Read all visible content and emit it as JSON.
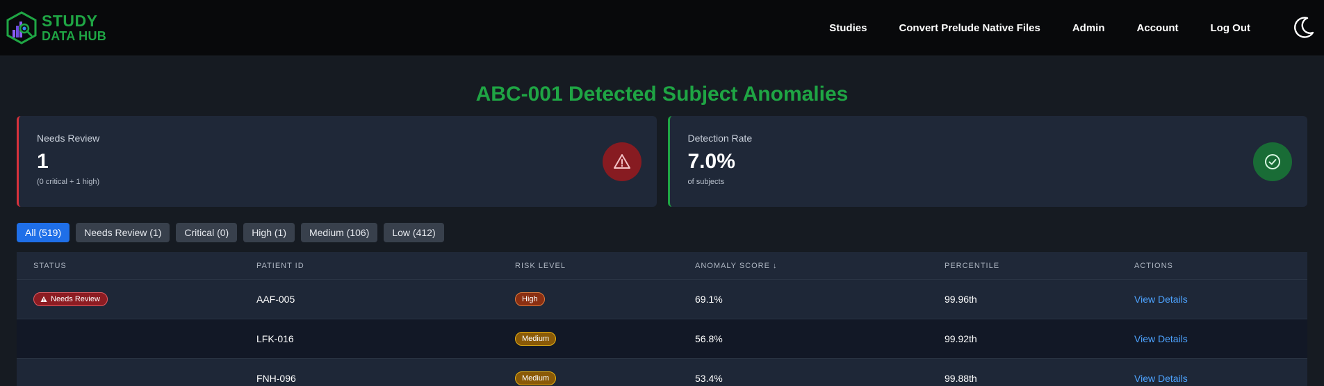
{
  "brand": {
    "line1": "STUDY",
    "line2": "DATA HUB",
    "accent": "#1fa544"
  },
  "nav": {
    "links": [
      "Studies",
      "Convert Prelude Native Files",
      "Admin",
      "Account",
      "Log Out"
    ],
    "theme_icon": "moon-icon"
  },
  "page": {
    "title": "ABC-001 Detected Subject Anomalies"
  },
  "cards": [
    {
      "label": "Needs Review",
      "value": "1",
      "sub": "(0 critical + 1 high)",
      "icon": "warning-icon",
      "color": "#d8323c"
    },
    {
      "label": "Detection Rate",
      "value": "7.0%",
      "sub": "of subjects",
      "icon": "check-circle-icon",
      "color": "#1fa544"
    }
  ],
  "filters": [
    {
      "label": "All (519)",
      "active": true
    },
    {
      "label": "Needs Review (1)",
      "active": false
    },
    {
      "label": "Critical (0)",
      "active": false
    },
    {
      "label": "High (1)",
      "active": false
    },
    {
      "label": "Medium (106)",
      "active": false
    },
    {
      "label": "Low (412)",
      "active": false
    }
  ],
  "table": {
    "headers": [
      "Status",
      "Patient ID",
      "Risk Level",
      "Anomaly Score ↓",
      "Percentile",
      "Actions"
    ],
    "rows": [
      {
        "status": "Needs Review",
        "patient_id": "AAF-005",
        "risk": "High",
        "score": "69.1%",
        "percentile": "99.96th",
        "action": "View Details"
      },
      {
        "status": "",
        "patient_id": "LFK-016",
        "risk": "Medium",
        "score": "56.8%",
        "percentile": "99.92th",
        "action": "View Details"
      },
      {
        "status": "",
        "patient_id": "FNH-096",
        "risk": "Medium",
        "score": "53.4%",
        "percentile": "99.88th",
        "action": "View Details"
      }
    ]
  }
}
